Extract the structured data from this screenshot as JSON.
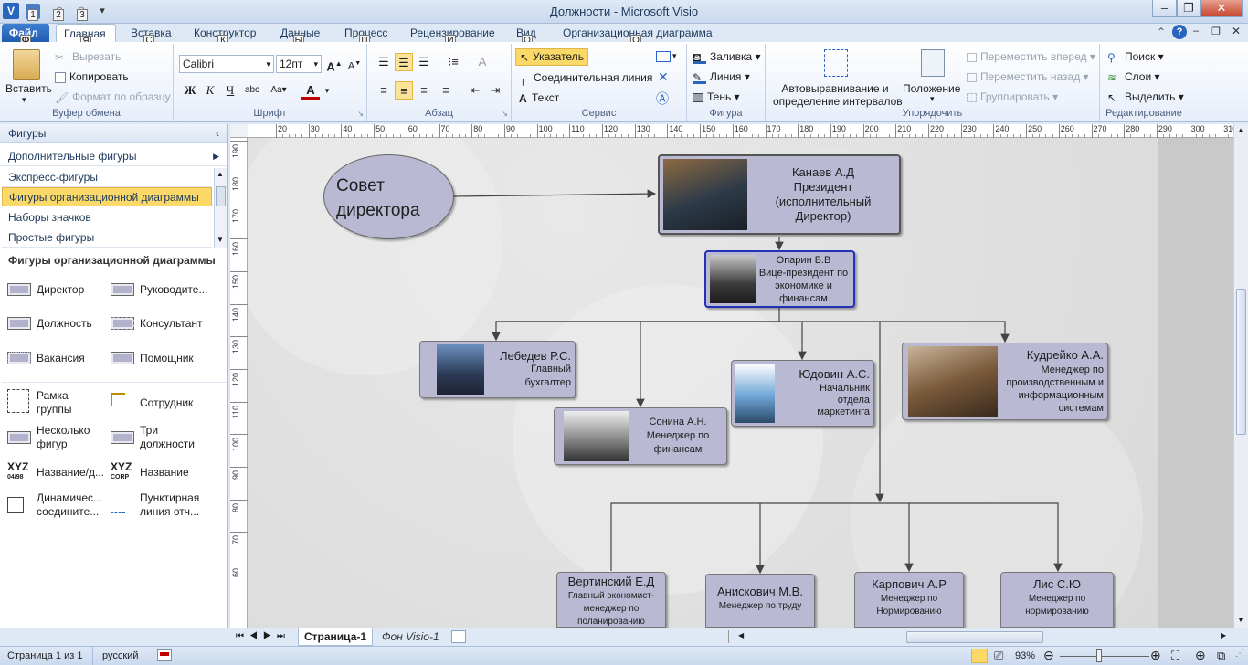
{
  "app": {
    "window_title": "Должности  -  Microsoft Visio",
    "app_icon_letter": "V"
  },
  "quick_access": {
    "keytips": [
      "1",
      "2",
      "3"
    ]
  },
  "tabs": [
    {
      "label": "Файл",
      "keytip": "Ф"
    },
    {
      "label": "Главная",
      "keytip": "Я"
    },
    {
      "label": "Вставка",
      "keytip": "С"
    },
    {
      "label": "Конструктор",
      "keytip": "К"
    },
    {
      "label": "Данные",
      "keytip": "Ы"
    },
    {
      "label": "Процесс",
      "keytip": "П"
    },
    {
      "label": "Рецензирование",
      "keytip": "И"
    },
    {
      "label": "Вид",
      "keytip": "О"
    },
    {
      "label": "Организационная диаграмма",
      "keytip": "О"
    }
  ],
  "ribbon": {
    "clipboard": {
      "label": "Буфер обмена",
      "paste": "Вставить",
      "cut": "Вырезать",
      "copy": "Копировать",
      "format_painter": "Формат по образцу"
    },
    "font": {
      "label": "Шрифт",
      "family": "Calibri",
      "size": "12пт"
    },
    "paragraph": {
      "label": "Абзац"
    },
    "tools": {
      "label": "Сервис",
      "pointer": "Указатель",
      "connector": "Соединительная линия",
      "text": "Текст"
    },
    "shape": {
      "label": "Фигура",
      "fill": "Заливка",
      "line": "Линия",
      "shadow": "Тень"
    },
    "arrange": {
      "label": "Упорядочить",
      "auto_align_1": "Автовыравнивание и",
      "auto_align_2": "определение интервалов",
      "position": "Положение",
      "bring_forward": "Переместить вперед",
      "send_backward": "Переместить назад",
      "group": "Группировать"
    },
    "editing": {
      "label": "Редактирование",
      "find": "Поиск",
      "layers": "Слои",
      "select": "Выделить"
    }
  },
  "shapes_panel": {
    "title": "Фигуры",
    "more_shapes": "Дополнительные фигуры",
    "stencils": [
      "Экспресс-фигуры",
      "Фигуры организационной диаграммы",
      "Наборы значков",
      "Простые фигуры"
    ],
    "section_title": "Фигуры организационной диаграммы",
    "items": [
      {
        "label": "Директор"
      },
      {
        "label": "Руководите..."
      },
      {
        "label": "Должность"
      },
      {
        "label": "Консультант"
      },
      {
        "label": "Вакансия"
      },
      {
        "label": "Помощник"
      },
      {
        "label": "Рамка группы"
      },
      {
        "label": "Сотрудник"
      },
      {
        "label": "Несколько фигур"
      },
      {
        "label": "Три должности"
      },
      {
        "label": "Название/д..."
      },
      {
        "label": "Название"
      },
      {
        "label": "Динамичес... соедините..."
      },
      {
        "label": "Пунктирная линия отч..."
      }
    ],
    "xyz_icon_text": "XYZ",
    "xyz_sub_1": "04/98",
    "xyz_sub_2": "CORP"
  },
  "ruler": {
    "h_ticks": [
      "20",
      "30",
      "40",
      "50",
      "60",
      "70",
      "80",
      "90",
      "100",
      "110",
      "120",
      "130",
      "140",
      "150",
      "160",
      "170",
      "180",
      "190",
      "200",
      "210",
      "220",
      "230",
      "240",
      "250",
      "260",
      "270",
      "280",
      "290",
      "300",
      "310"
    ],
    "v_ticks": [
      "190",
      "180",
      "170",
      "160",
      "150",
      "140",
      "130",
      "120",
      "110",
      "100",
      "90",
      "80",
      "70",
      "60"
    ]
  },
  "diagram": {
    "board": "Совет директора",
    "nodes": {
      "president": {
        "name": "Канаев А.Д",
        "title": "Президент (исполнительный Директор)"
      },
      "vp": {
        "name": "Опарин Б.В",
        "title": "Вице-президент по экономике и финансам"
      },
      "lebedev": {
        "name": "Лебедев Р.С.",
        "title": "Главный бухгалтер"
      },
      "sonina": {
        "name": "Сонина А.Н.",
        "title": "Менеджер по финансам"
      },
      "yudovin": {
        "name": "Юдовин А.С.",
        "title": "Начальник отдела маркетинга"
      },
      "kudreyko": {
        "name": "Кудрейко А.А.",
        "title": "Менеджер по производственным и информационным системам"
      },
      "vertinsky": {
        "name": "Вертинский Е.Д",
        "title": "Главный экономист-менеджер по поланированию"
      },
      "aniskovich": {
        "name": "Анискович М.В.",
        "title": "Менеджер по труду"
      },
      "karpovich": {
        "name": "Карпович А.Р",
        "title": "Менеджер по Нормированию"
      },
      "lis": {
        "name": "Лис С.Ю",
        "title": "Менеджер по нормированию"
      }
    }
  },
  "page_tabs": [
    "Страница-1",
    "Фон Visio-1"
  ],
  "status": {
    "page": "Страница 1 из 1",
    "language": "русский",
    "zoom": "93%"
  },
  "colors": {
    "node_fill": "#bab9d3",
    "selected_stencil": "#fbd969",
    "file_tab": "#2a65bd"
  }
}
